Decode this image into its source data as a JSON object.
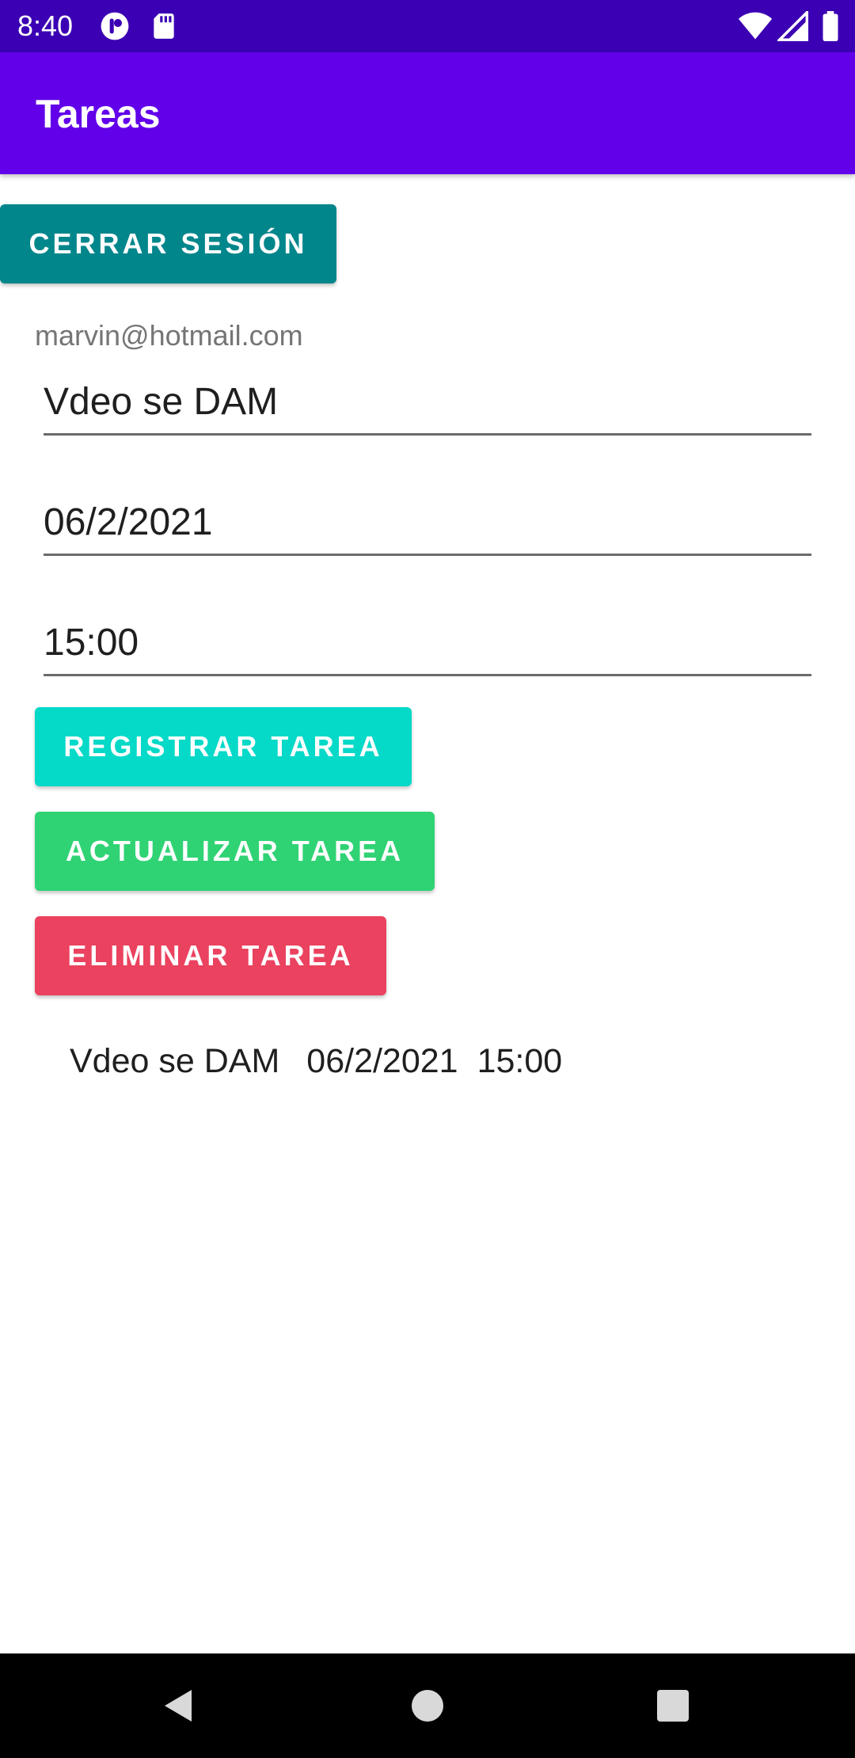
{
  "status_bar": {
    "time": "8:40",
    "icons": [
      "notification-app-icon",
      "sd-card-icon",
      "wifi-icon",
      "cell-signal-icon",
      "battery-icon"
    ]
  },
  "app_bar": {
    "title": "Tareas"
  },
  "logout_button": {
    "label": "CERRAR SESIÓN"
  },
  "user": {
    "email": "marvin@hotmail.com"
  },
  "form": {
    "task_value": "Vdeo se DAM",
    "date_value": "06/2/2021",
    "time_value": "15:00"
  },
  "actions": {
    "register_label": "REGISTRAR TAREA",
    "update_label": "ACTUALIZAR TAREA",
    "delete_label": "ELIMINAR TAREA"
  },
  "tasks": [
    {
      "name": "Vdeo se DAM",
      "date": "06/2/2021",
      "time": "15:00"
    }
  ],
  "navigation": {
    "icons": [
      "back-icon",
      "home-icon",
      "recent-apps-icon"
    ]
  },
  "colors": {
    "status_bar": "#3b00b3",
    "app_bar": "#6200ea",
    "logout_button": "#00868b",
    "register_button": "#05d9c8",
    "update_button": "#2fd374",
    "delete_button": "#ea425f"
  }
}
